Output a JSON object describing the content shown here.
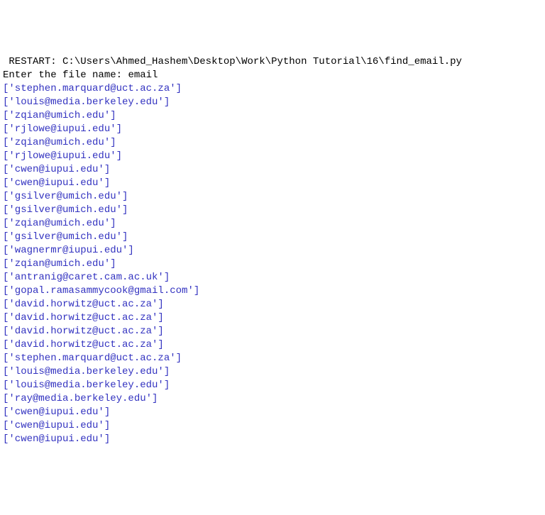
{
  "restart": {
    "label": "RESTART",
    "path": "C:\\Users\\Ahmed_Hashem\\Desktop\\Work\\Python Tutorial\\16\\find_email.py"
  },
  "prompt": {
    "text": "Enter the file name: ",
    "user_input": "email"
  },
  "output_lines": [
    "['stephen.marquard@uct.ac.za']",
    "['louis@media.berkeley.edu']",
    "['zqian@umich.edu']",
    "['rjlowe@iupui.edu']",
    "['zqian@umich.edu']",
    "['rjlowe@iupui.edu']",
    "['cwen@iupui.edu']",
    "['cwen@iupui.edu']",
    "['gsilver@umich.edu']",
    "['gsilver@umich.edu']",
    "['zqian@umich.edu']",
    "['gsilver@umich.edu']",
    "['wagnermr@iupui.edu']",
    "['zqian@umich.edu']",
    "['antranig@caret.cam.ac.uk']",
    "['gopal.ramasammycook@gmail.com']",
    "['david.horwitz@uct.ac.za']",
    "['david.horwitz@uct.ac.za']",
    "['david.horwitz@uct.ac.za']",
    "['david.horwitz@uct.ac.za']",
    "['stephen.marquard@uct.ac.za']",
    "['louis@media.berkeley.edu']",
    "['louis@media.berkeley.edu']",
    "['ray@media.berkeley.edu']",
    "['cwen@iupui.edu']",
    "['cwen@iupui.edu']",
    "['cwen@iupui.edu']"
  ]
}
